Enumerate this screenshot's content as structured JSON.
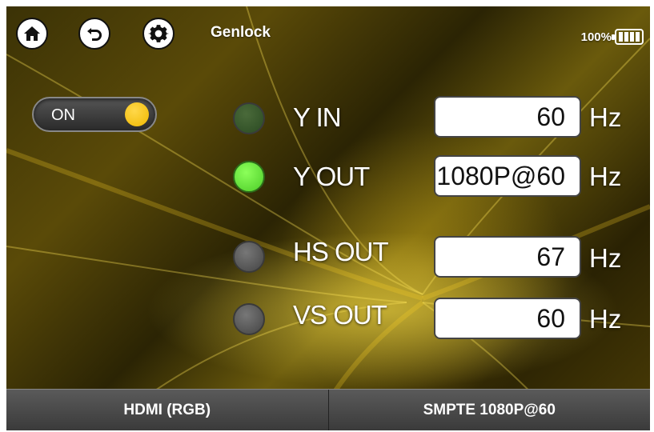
{
  "header": {
    "title": "Genlock",
    "battery_text": "100%",
    "icons": [
      "home-icon",
      "back-icon",
      "gear-icon",
      "battery-icon"
    ]
  },
  "toggle": {
    "label": "ON",
    "state": "on",
    "knob_color": "#f5c400"
  },
  "signals": [
    {
      "label": "Y IN",
      "value": "60",
      "unit": "Hz",
      "led": "dark"
    },
    {
      "label": "Y OUT",
      "value": "1080P@60",
      "unit": "Hz",
      "led": "on"
    },
    {
      "label": "HS OUT",
      "value": "67",
      "unit": "Hz",
      "led": "off"
    },
    {
      "label": "VS OUT",
      "value": "60",
      "unit": "Hz",
      "led": "off"
    }
  ],
  "footer": {
    "left_label": "HDMI (RGB)",
    "right_label": "SMPTE 1080P@60"
  },
  "colors": {
    "accent_yellow": "#f5c400",
    "led_green": "#6fe63a"
  }
}
